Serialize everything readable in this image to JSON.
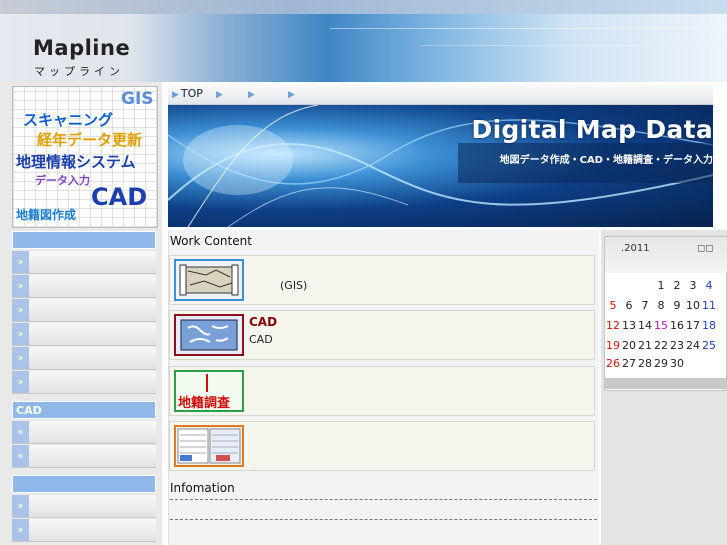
{
  "brand": {
    "name": "Mapline",
    "kana": "マップライン"
  },
  "promo": {
    "gis": "GIS",
    "scanning": "スキャニング",
    "aging": "経年データ更新",
    "gis_system": "地理情報システム",
    "data_input": "データ入力",
    "cad": "CAD",
    "map_drawing": "地籍図作成"
  },
  "sidebar": {
    "groups": [
      {
        "title": "",
        "items": [
          "",
          "",
          "",
          "",
          "",
          "",
          ""
        ]
      },
      {
        "title": "CAD",
        "items": [
          "",
          ""
        ]
      },
      {
        "title": "",
        "items": [
          "",
          ""
        ]
      }
    ],
    "arrow": "»"
  },
  "nav": {
    "items": [
      "TOP",
      "",
      "",
      ""
    ]
  },
  "banner": {
    "title": "Digital Map Data",
    "subtitle": "地図データ作成・CAD・地籍調査・データ入力"
  },
  "work": {
    "title": "Work Content",
    "cards": [
      {
        "heading": "",
        "text": "(GIS)"
      },
      {
        "heading": "CAD",
        "text": "CAD"
      },
      {
        "heading": "",
        "text": "",
        "thumb_label": "地籍調査"
      },
      {
        "heading": "",
        "text": ""
      }
    ]
  },
  "info": {
    "title": "Infomation"
  },
  "calendar": {
    "title": ".2011",
    "rows": [
      [
        "",
        "",
        "",
        "1",
        "2",
        "3",
        "4"
      ],
      [
        "5",
        "6",
        "7",
        "8",
        "9",
        "10",
        "11"
      ],
      [
        "12",
        "13",
        "14",
        "15",
        "16",
        "17",
        "18"
      ],
      [
        "19",
        "20",
        "21",
        "22",
        "23",
        "24",
        "25"
      ],
      [
        "26",
        "27",
        "28",
        "29",
        "30",
        "",
        ""
      ]
    ]
  },
  "colors": {
    "accent": "#8fb7e8",
    "holiday": "#d41010",
    "saturday": "#2040c0",
    "today": "#b020b0",
    "cad_heading": "#8b0000"
  }
}
